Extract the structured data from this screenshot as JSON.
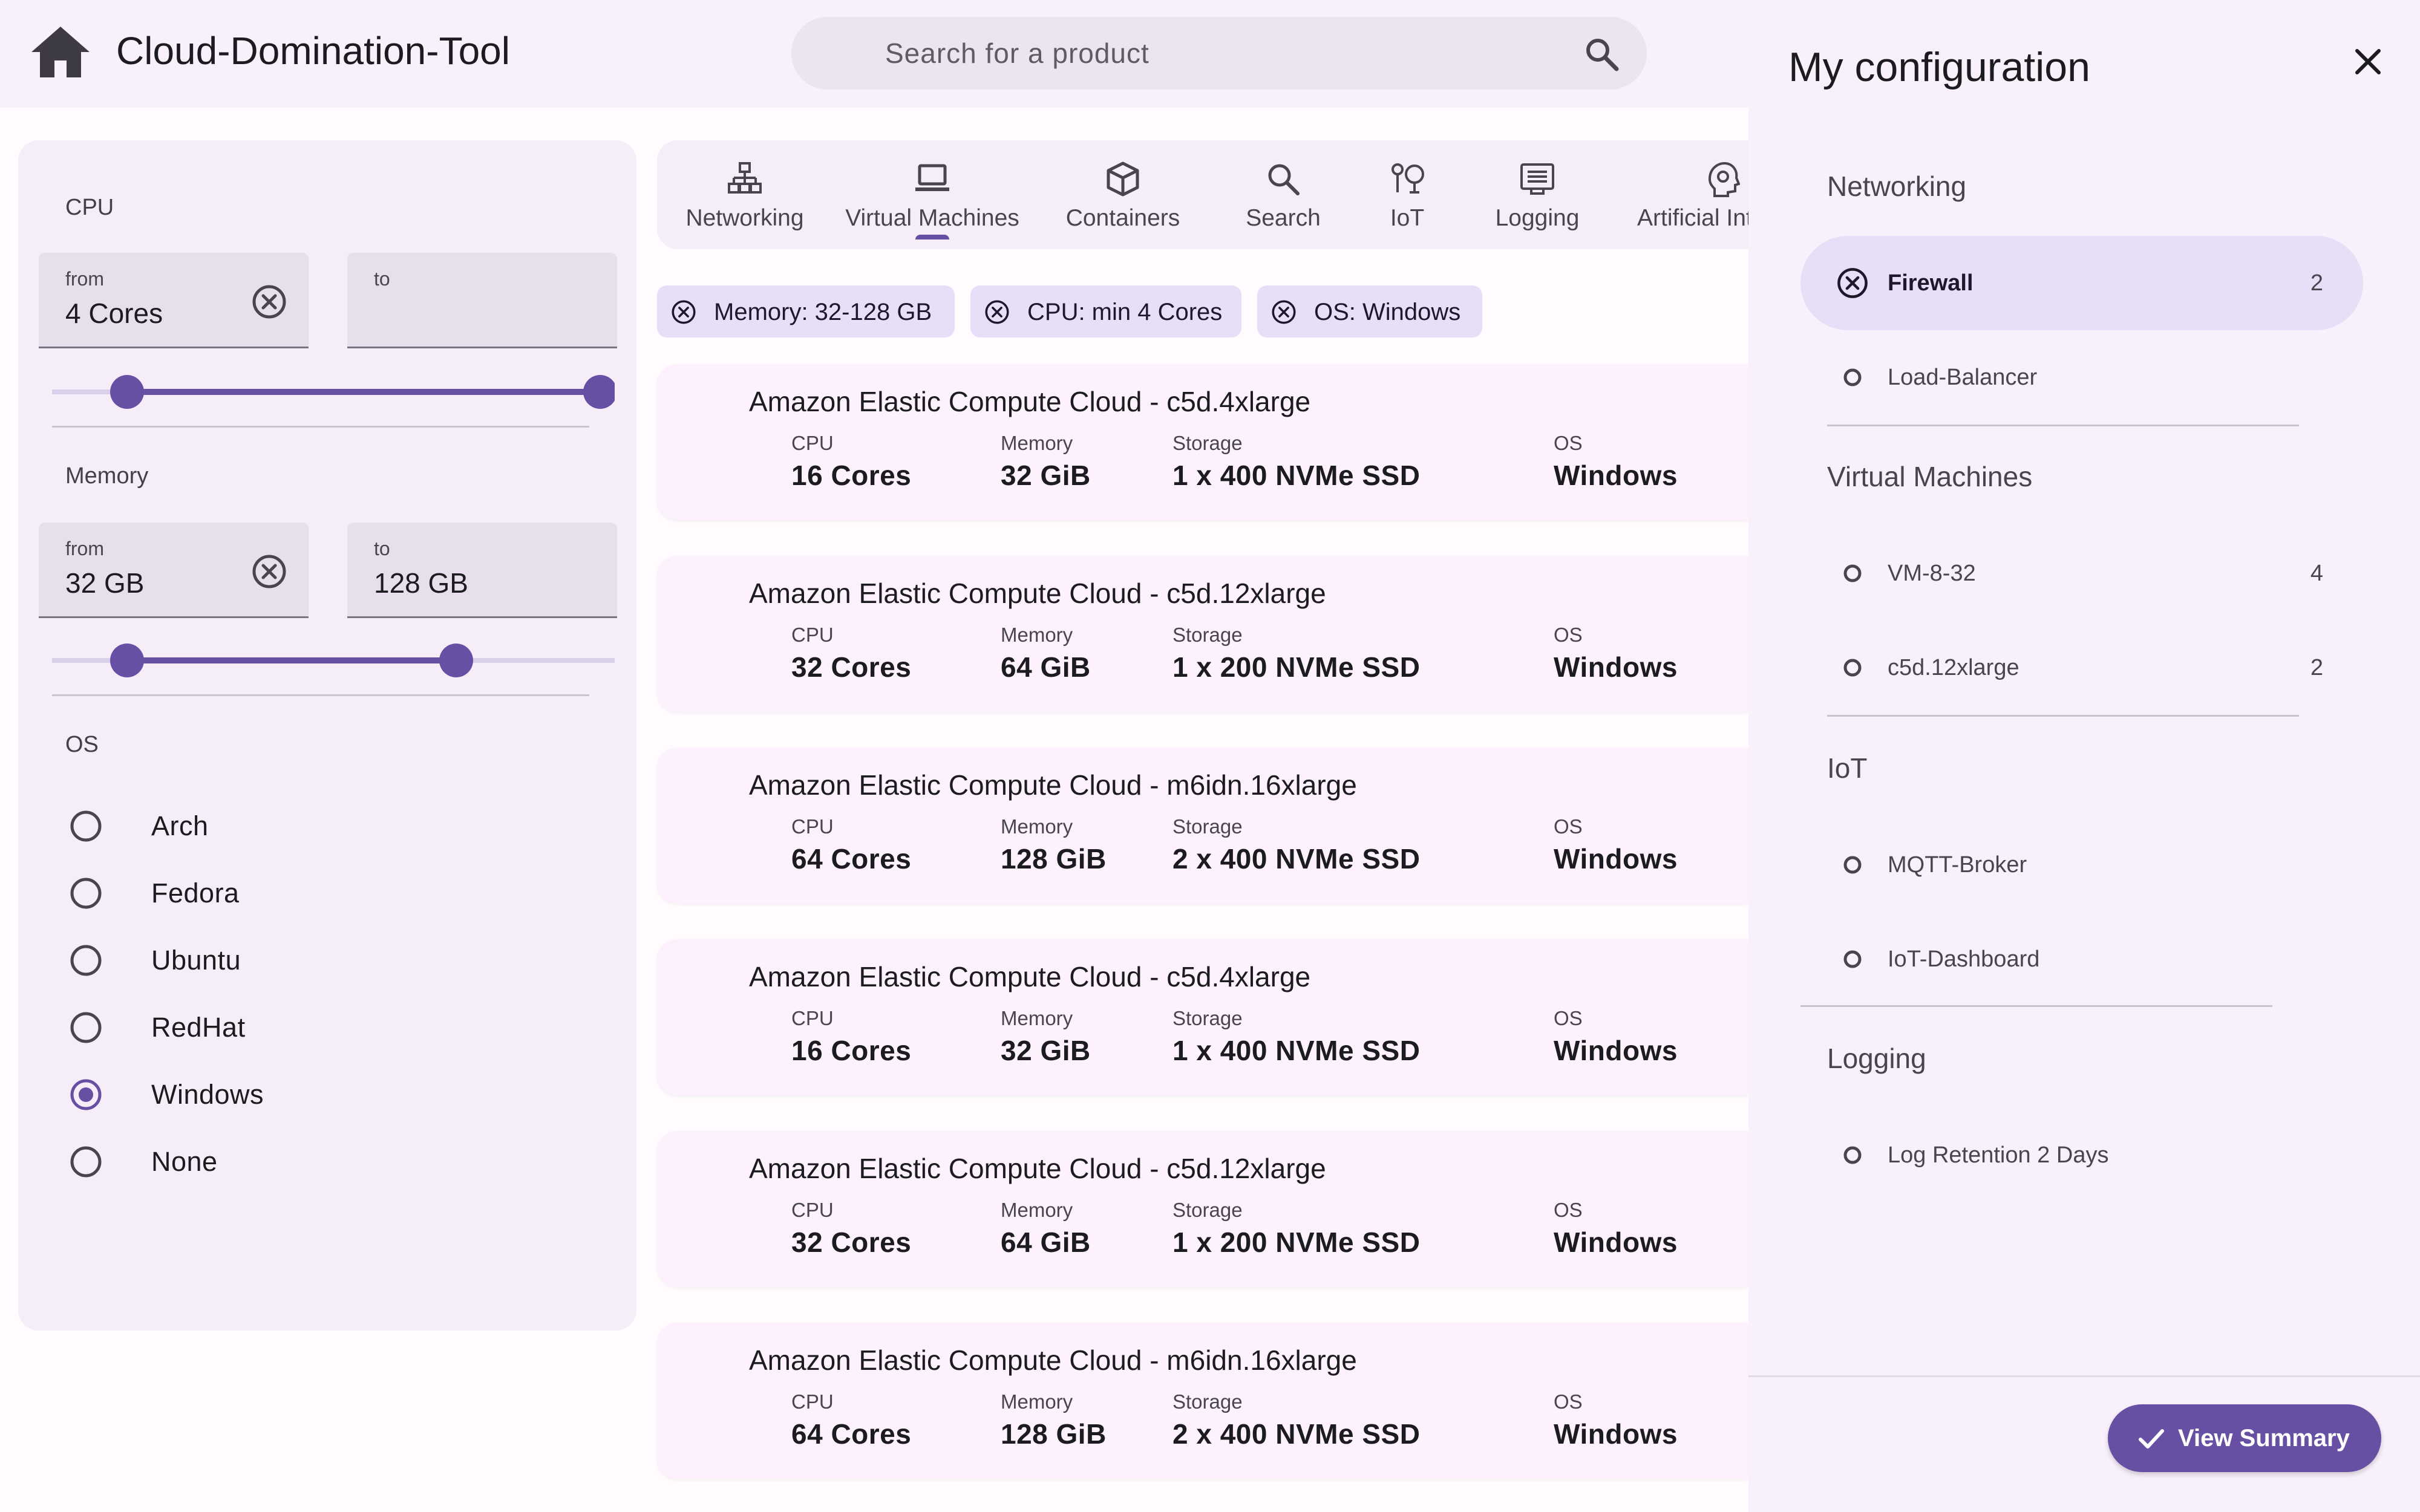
{
  "app": {
    "title": "Cloud-Domination-Tool"
  },
  "search": {
    "placeholder": "Search for a product"
  },
  "filters": {
    "cpu": {
      "label": "CPU",
      "from_label": "from",
      "from_value": "4 Cores",
      "to_label": "to",
      "to_value": ""
    },
    "memory": {
      "label": "Memory",
      "from_label": "from",
      "from_value": "32 GB",
      "to_label": "to",
      "to_value": "128 GB"
    },
    "os": {
      "label": "OS",
      "selected": "Windows",
      "options": [
        "Arch",
        "Fedora",
        "Ubuntu",
        "RedHat",
        "Windows",
        "None"
      ]
    }
  },
  "tabs": [
    {
      "label": "Networking",
      "icon": "network-icon"
    },
    {
      "label": "Virtual Machines",
      "icon": "laptop-icon",
      "active": true
    },
    {
      "label": "Containers",
      "icon": "box-icon"
    },
    {
      "label": "Search",
      "icon": "search-icon"
    },
    {
      "label": "IoT",
      "icon": "iot-icon"
    },
    {
      "label": "Logging",
      "icon": "list-icon"
    },
    {
      "label": "Artificial Intellig",
      "icon": "ai-head-icon"
    }
  ],
  "chips": [
    {
      "label": "Memory: 32-128 GB"
    },
    {
      "label": "CPU: min 4 Cores"
    },
    {
      "label": "OS: Windows"
    }
  ],
  "spec_labels": {
    "cpu": "CPU",
    "memory": "Memory",
    "storage": "Storage",
    "os": "OS"
  },
  "products": [
    {
      "title": "Amazon Elastic Compute Cloud - c5d.4xlarge",
      "cpu": "16 Cores",
      "memory": "32 GiB",
      "storage": "1 x 400 NVMe SSD",
      "os": "Windows"
    },
    {
      "title": "Amazon Elastic Compute Cloud - c5d.12xlarge",
      "cpu": "32 Cores",
      "memory": "64 GiB",
      "storage": "1 x 200 NVMe SSD",
      "os": "Windows"
    },
    {
      "title": "Amazon Elastic Compute Cloud - m6idn.16xlarge",
      "cpu": "64 Cores",
      "memory": "128 GiB",
      "storage": "2 x 400 NVMe SSD",
      "os": "Windows"
    },
    {
      "title": "Amazon Elastic Compute Cloud - c5d.4xlarge",
      "cpu": "16 Cores",
      "memory": "32 GiB",
      "storage": "1 x 400 NVMe SSD",
      "os": "Windows"
    },
    {
      "title": "Amazon Elastic Compute Cloud - c5d.12xlarge",
      "cpu": "32 Cores",
      "memory": "64 GiB",
      "storage": "1 x 200 NVMe SSD",
      "os": "Windows"
    },
    {
      "title": "Amazon Elastic Compute Cloud - m6idn.16xlarge",
      "cpu": "64 Cores",
      "memory": "128 GiB",
      "storage": "2 x 400 NVMe SSD",
      "os": "Windows"
    }
  ],
  "configuration": {
    "title": "My configuration",
    "groups": [
      {
        "name": "Networking",
        "items": [
          {
            "label": "Firewall",
            "count": "2",
            "active": true
          },
          {
            "label": "Load-Balancer",
            "count": ""
          }
        ]
      },
      {
        "name": "Virtual Machines",
        "items": [
          {
            "label": "VM-8-32",
            "count": "4"
          },
          {
            "label": "c5d.12xlarge",
            "count": "2"
          }
        ]
      },
      {
        "name": "IoT",
        "items": [
          {
            "label": "MQTT-Broker",
            "count": ""
          },
          {
            "label": "IoT-Dashboard",
            "count": ""
          }
        ]
      },
      {
        "name": "Logging",
        "items": [
          {
            "label": "Log Retention 2 Days",
            "count": ""
          }
        ]
      }
    ],
    "summary_button": "View Summary"
  },
  "colors": {
    "accent": "#6750a4",
    "chip": "#e8def8",
    "panel": "#f5eef8",
    "card": "#fcf1fc"
  }
}
